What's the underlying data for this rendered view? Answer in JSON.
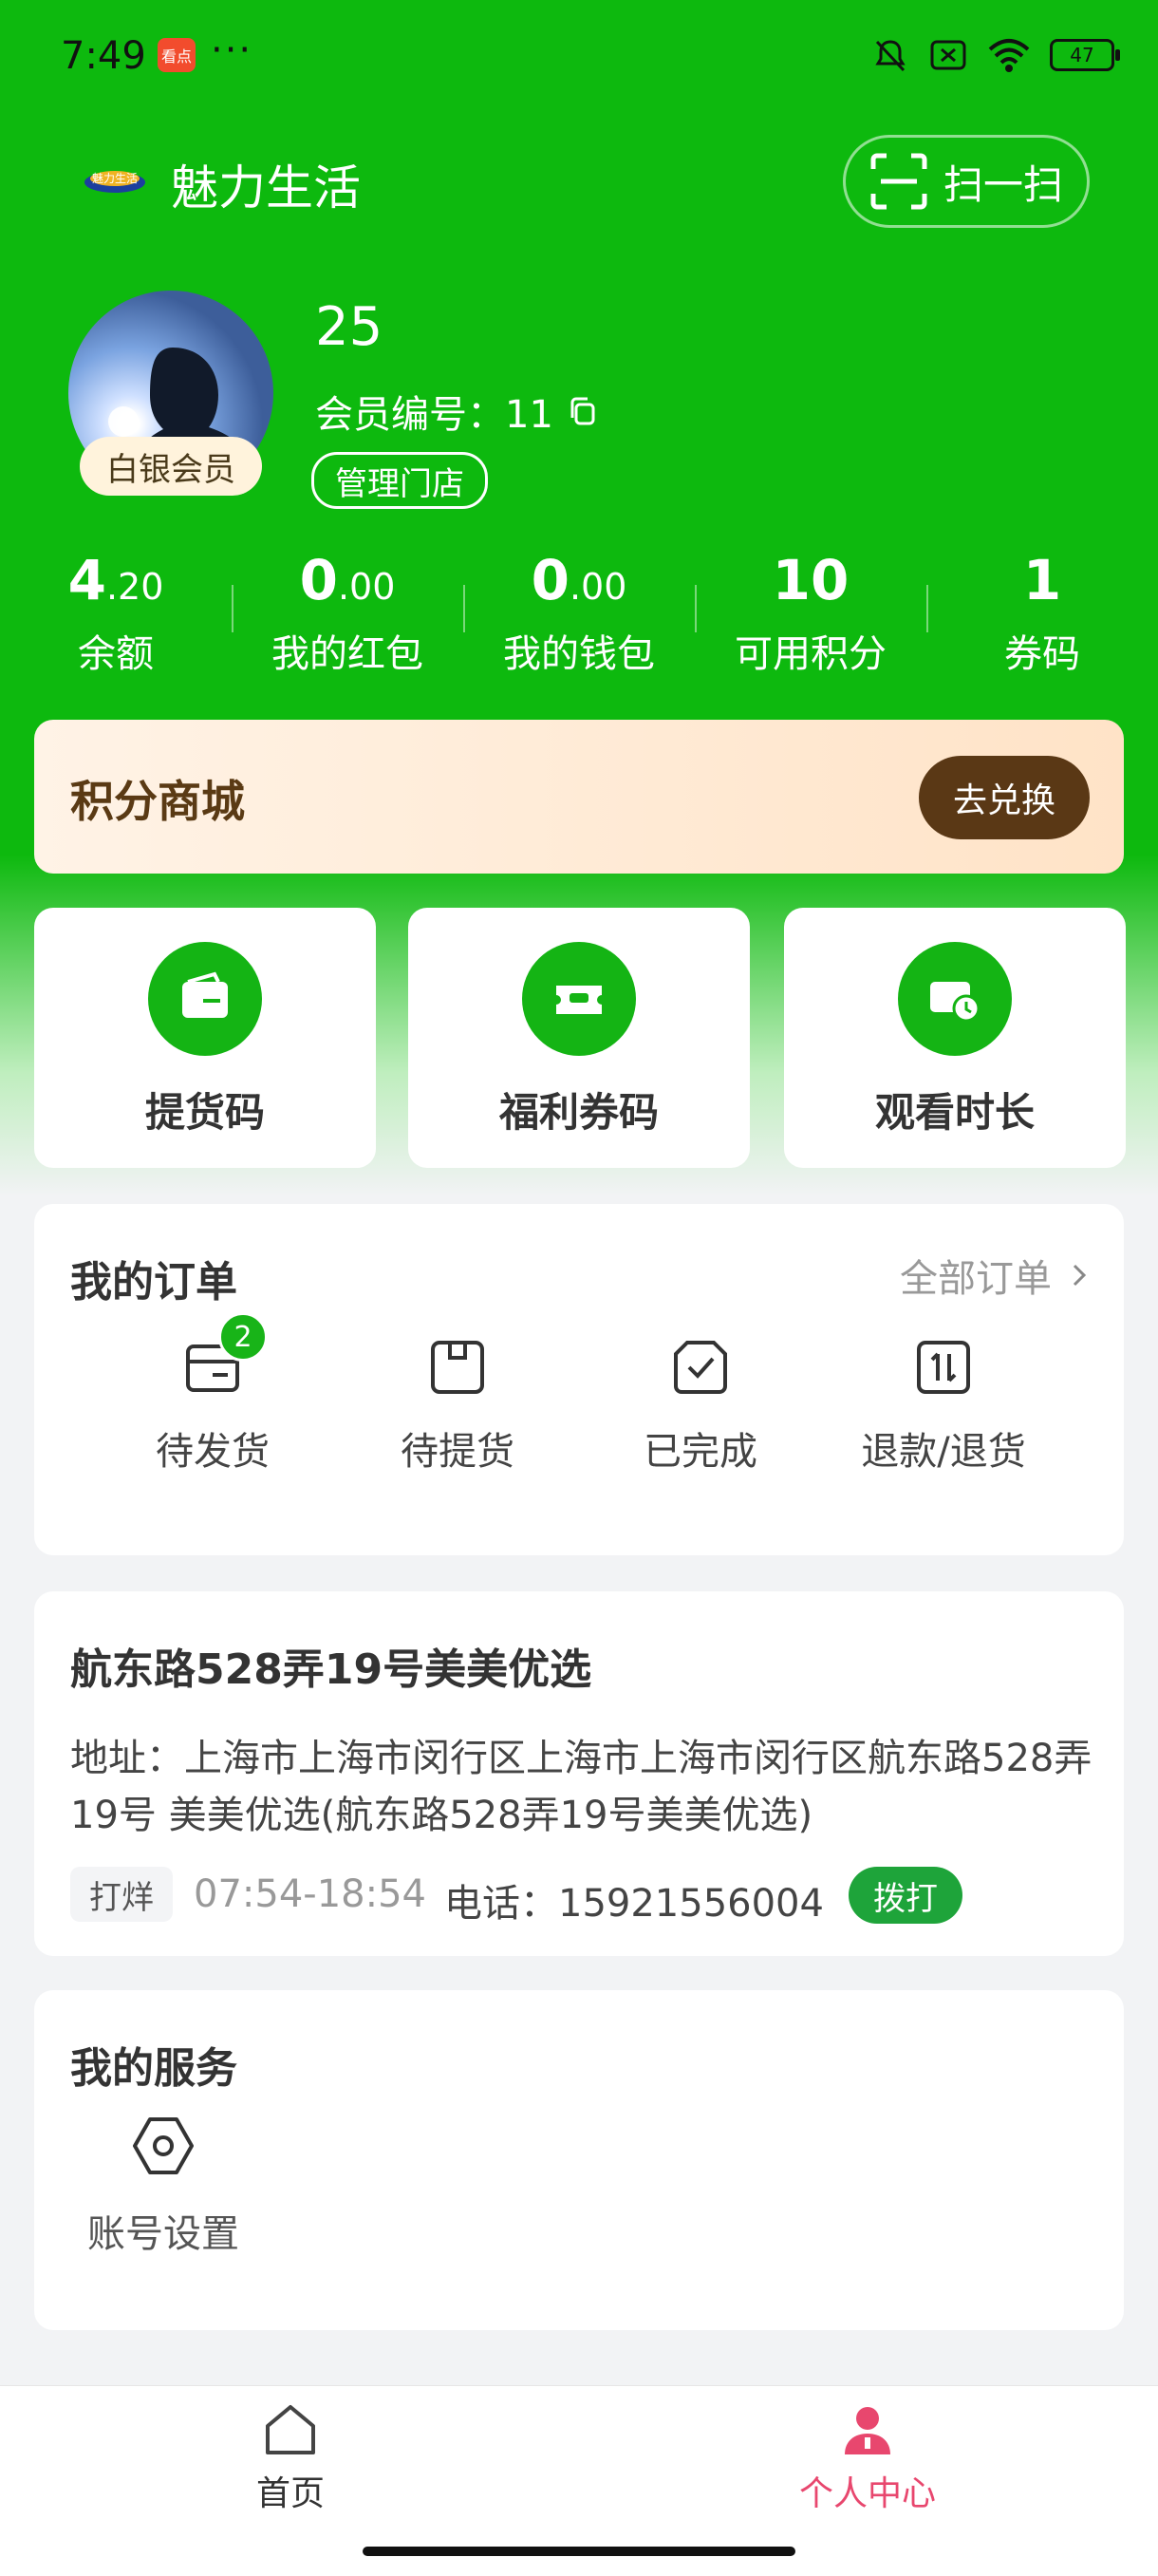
{
  "status_bar": {
    "time": "7:49",
    "app_icon_text": "看点",
    "dots": "···",
    "battery": "47"
  },
  "header": {
    "logo_text": "魅力生活",
    "title": "魅力生活",
    "scan_label": "扫一扫"
  },
  "profile": {
    "name": "25",
    "member_level": "白银会员",
    "member_no_label": "会员编号：11",
    "manage_store_label": "管理门店"
  },
  "stats": [
    {
      "int": "4",
      "dec": ".20",
      "label": "余额"
    },
    {
      "int": "0",
      "dec": ".00",
      "label": "我的红包"
    },
    {
      "int": "0",
      "dec": ".00",
      "label": "我的钱包"
    },
    {
      "int": "10",
      "dec": "",
      "label": "可用积分"
    },
    {
      "int": "1",
      "dec": "",
      "label": "券码"
    }
  ],
  "points_mall": {
    "title": "积分商城",
    "button": "去兑换"
  },
  "quick_actions": [
    {
      "label": "提货码",
      "icon": "wallet-icon"
    },
    {
      "label": "福利券码",
      "icon": "coupon-icon"
    },
    {
      "label": "观看时长",
      "icon": "video-clock-icon"
    }
  ],
  "orders": {
    "title": "我的订单",
    "all_label": "全部订单",
    "items": [
      {
        "label": "待发货",
        "badge": "2",
        "icon": "pending-ship-icon"
      },
      {
        "label": "待提货",
        "icon": "pending-pickup-icon"
      },
      {
        "label": "已完成",
        "icon": "completed-icon"
      },
      {
        "label": "退款/退货",
        "icon": "refund-icon"
      }
    ]
  },
  "store": {
    "name": "航东路528弄19号美美优选",
    "address": "地址：上海市上海市闵行区上海市上海市闵行区航东路528弄19号 美美优选(航东路528弄19号美美优选)",
    "tag": "打烊",
    "hours": "07:54-18:54",
    "phone": "电话：15921556004",
    "call_label": "拨打"
  },
  "services": {
    "title": "我的服务",
    "items": [
      {
        "label": "账号设置",
        "icon": "settings-icon"
      }
    ]
  },
  "bottom_nav": [
    {
      "label": "首页",
      "icon": "home-icon",
      "active": false
    },
    {
      "label": "个人中心",
      "icon": "user-icon",
      "active": true
    }
  ],
  "colors": {
    "primary_green": "#0db90e",
    "mall_button": "#5a3815",
    "active_nav": "#e8476e",
    "call_button": "#1ea43a"
  }
}
